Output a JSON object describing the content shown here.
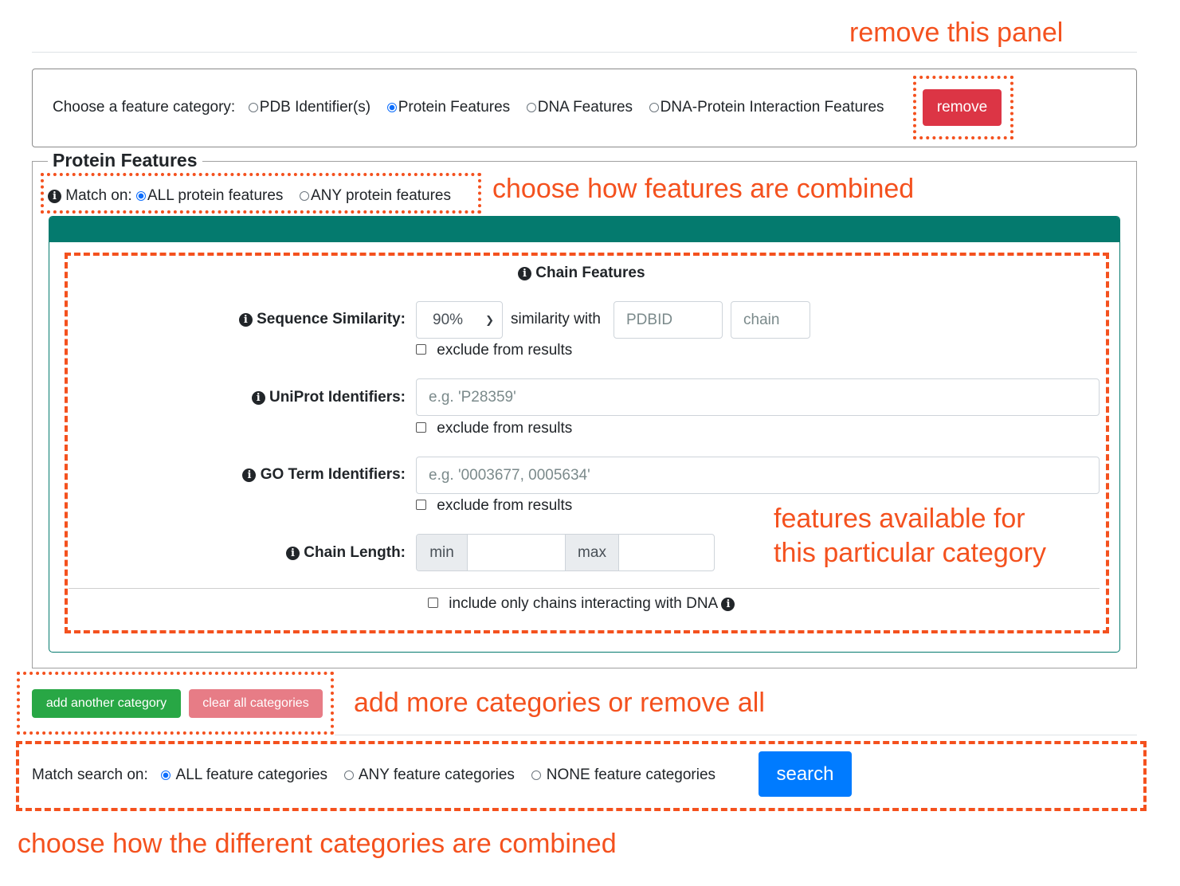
{
  "annotations": {
    "remove_panel": "remove this panel",
    "combine_features": "choose how features are combined",
    "features_available_1": "features available for",
    "features_available_2": "this particular category",
    "add_more": "add more categories or remove all",
    "combine_categories": "choose how the different categories are combined"
  },
  "category_panel": {
    "prompt": "Choose a feature category:",
    "options": [
      "PDB Identifier(s)",
      "Protein Features",
      "DNA Features",
      "DNA-Protein Interaction Features"
    ],
    "selected": "Protein Features",
    "remove_label": "remove"
  },
  "protein_features": {
    "legend": "Protein Features",
    "match_label": "Match on:",
    "match_options": [
      "ALL protein features",
      "ANY protein features"
    ],
    "match_selected": "ALL protein features",
    "header_color": "#047a6e",
    "section_title": "Chain Features",
    "sequence_similarity": {
      "label": "Sequence Similarity:",
      "selected": "90%",
      "with_text": "similarity with",
      "pdbid_placeholder": "PDBID",
      "chain_placeholder": "chain",
      "exclude_label": "exclude from results"
    },
    "uniprot": {
      "label": "UniProt Identifiers:",
      "placeholder": "e.g. 'P28359'",
      "exclude_label": "exclude from results"
    },
    "go_terms": {
      "label": "GO Term Identifiers:",
      "placeholder": "e.g. '0003677, 0005634'",
      "exclude_label": "exclude from results"
    },
    "chain_length": {
      "label": "Chain Length:",
      "min_label": "min",
      "max_label": "max"
    },
    "dna_interacting_label": "include only chains interacting with DNA"
  },
  "actions": {
    "add_label": "add another category",
    "clear_label": "clear all categories",
    "add_color": "#28a745",
    "clear_color": "#e77c86"
  },
  "search_bar": {
    "label": "Match search on:",
    "options": [
      "ALL feature categories",
      "ANY feature categories",
      "NONE feature categories"
    ],
    "selected": "ALL feature categories",
    "search_label": "search",
    "search_color": "#007bff"
  }
}
